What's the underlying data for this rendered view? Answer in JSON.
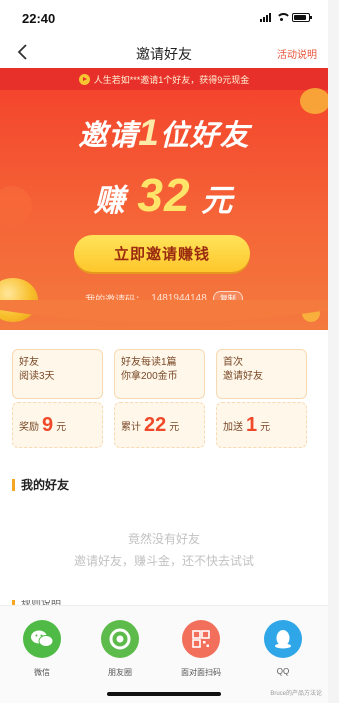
{
  "status_bar": {
    "time": "22:40"
  },
  "nav": {
    "title": "邀请好友",
    "help": "活动说明"
  },
  "hero": {
    "notice": "人生若如***邀请1个好友，获得9元现金",
    "line1_prefix": "邀请",
    "line1_num": "1",
    "line1_suffix": "位好友",
    "line2_prefix": "赚",
    "line2_num": "32",
    "line2_suffix": "元",
    "button": "立即邀请赚钱",
    "code_label": "我的邀请码：",
    "code_value": "1481944148",
    "copy": "复制"
  },
  "cards": [
    {
      "line1": "好友",
      "line2": "阅读3天",
      "reward_label": "奖励",
      "reward_value": "9",
      "reward_unit": "元"
    },
    {
      "line1": "好友每读1篇",
      "line2": "你拿200金币",
      "reward_label": "累计",
      "reward_value": "22",
      "reward_unit": "元"
    },
    {
      "line1": "首次",
      "line2": "邀请好友",
      "reward_label": "加送",
      "reward_value": "1",
      "reward_unit": "元"
    }
  ],
  "friends": {
    "title": "我的好友",
    "empty_line1": "竟然没有好友",
    "empty_line2": "邀请好友，赚斗金，还不快去试试"
  },
  "rules": {
    "title": "规则说明"
  },
  "share": [
    {
      "label": "微信",
      "icon": "wechat-icon",
      "color": "#4fbb46"
    },
    {
      "label": "朋友圈",
      "icon": "moments-icon",
      "color": "#5cbb4a"
    },
    {
      "label": "面对面扫码",
      "icon": "qrcode-icon",
      "color": "#f2705b"
    },
    {
      "label": "QQ",
      "icon": "qq-icon",
      "color": "#2fa6e8"
    }
  ],
  "watermark": "Bruce的产品方法论",
  "colors": {
    "accent": "#f3402b",
    "button": "#fdc72c",
    "reward": "#f0492a"
  }
}
